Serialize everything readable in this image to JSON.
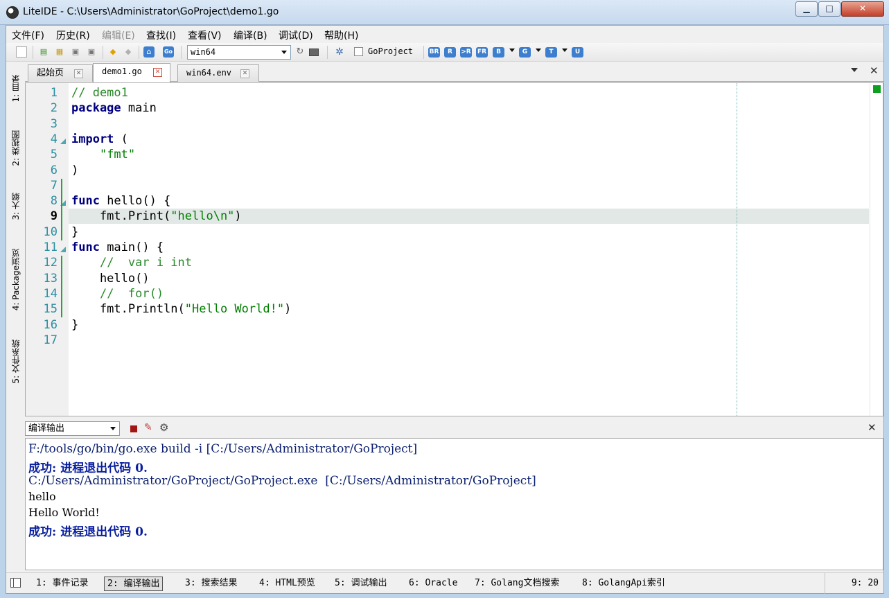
{
  "window": {
    "title": "LiteIDE - C:\\Users\\Administrator\\GoProject\\demo1.go"
  },
  "menu": [
    "文件(F)",
    "历史(R)",
    "编辑(E)",
    "查找(I)",
    "查看(V)",
    "编译(B)",
    "调试(D)",
    "帮助(H)"
  ],
  "toolbar": {
    "env_value": "win64",
    "project_label": "GoProject",
    "go_badge": "Go",
    "build_badges": [
      "BR",
      "R",
      ">R",
      "FR",
      "B",
      "G",
      "T",
      "U"
    ]
  },
  "left_dock": [
    "1: 目录",
    "2: 类视图",
    "3: 大纲",
    "4: Package浏览",
    "5: 文件系统"
  ],
  "tabs": [
    {
      "label": "起始页",
      "active": false
    },
    {
      "label": "demo1.go",
      "active": true
    },
    {
      "label": "win64.env",
      "active": false
    }
  ],
  "editor": {
    "current_line": 9,
    "line_numbers": [
      "1",
      "2",
      "3",
      "4",
      "5",
      "6",
      "7",
      "8",
      "9",
      "10",
      "11",
      "12",
      "13",
      "14",
      "15",
      "16",
      "17"
    ],
    "lines": [
      [
        [
          "c",
          "// demo1"
        ]
      ],
      [
        [
          "k",
          "package"
        ],
        [
          "t",
          " main"
        ]
      ],
      [],
      [
        [
          "k",
          "import"
        ],
        [
          "t",
          " ("
        ]
      ],
      [
        [
          "t",
          "    "
        ],
        [
          "s",
          "\"fmt\""
        ]
      ],
      [
        [
          "t",
          ")"
        ]
      ],
      [],
      [
        [
          "k",
          "func"
        ],
        [
          "t",
          " hello() {"
        ]
      ],
      [
        [
          "t",
          "    fmt.Print("
        ],
        [
          "s",
          "\"hello\\n\""
        ],
        [
          "t",
          ")"
        ]
      ],
      [
        [
          "t",
          "}"
        ]
      ],
      [
        [
          "k",
          "func"
        ],
        [
          "t",
          " main() {"
        ]
      ],
      [
        [
          "t",
          "    "
        ],
        [
          "c",
          "//  var i int"
        ]
      ],
      [
        [
          "t",
          "    hello()"
        ]
      ],
      [
        [
          "t",
          "    "
        ],
        [
          "c",
          "//  for()"
        ]
      ],
      [
        [
          "t",
          "    fmt.Println("
        ],
        [
          "s",
          "\"Hello World!\""
        ],
        [
          "t",
          ")"
        ]
      ],
      [
        [
          "t",
          "}"
        ]
      ],
      []
    ]
  },
  "output": {
    "selector": "编译输出",
    "lines": [
      {
        "kind": "cmd",
        "text": "F:/tools/go/bin/go.exe build -i [C:/Users/Administrator/GoProject]"
      },
      {
        "kind": "ok",
        "text": "成功: 进程退出代码 0."
      },
      {
        "kind": "cmd",
        "text": "C:/Users/Administrator/GoProject/GoProject.exe  [C:/Users/Administrator/GoProject]"
      },
      {
        "kind": "plain",
        "text": "hello"
      },
      {
        "kind": "plain",
        "text": "Hello World!"
      },
      {
        "kind": "ok",
        "text": "成功: 进程退出代码 0."
      }
    ]
  },
  "bottom_tabs": [
    {
      "label": "1: 事件记录",
      "active": false
    },
    {
      "label": "2: 编译输出",
      "active": true
    },
    {
      "label": "3: 搜索结果",
      "active": false
    },
    {
      "label": "4: HTML预览",
      "active": false
    },
    {
      "label": "5: 调试输出",
      "active": false
    },
    {
      "label": "6: Oracle",
      "active": false
    },
    {
      "label": "7: Golang文档搜索",
      "active": false
    },
    {
      "label": "8: GolangApi索引",
      "active": false
    }
  ],
  "status": {
    "position": "9: 20"
  }
}
